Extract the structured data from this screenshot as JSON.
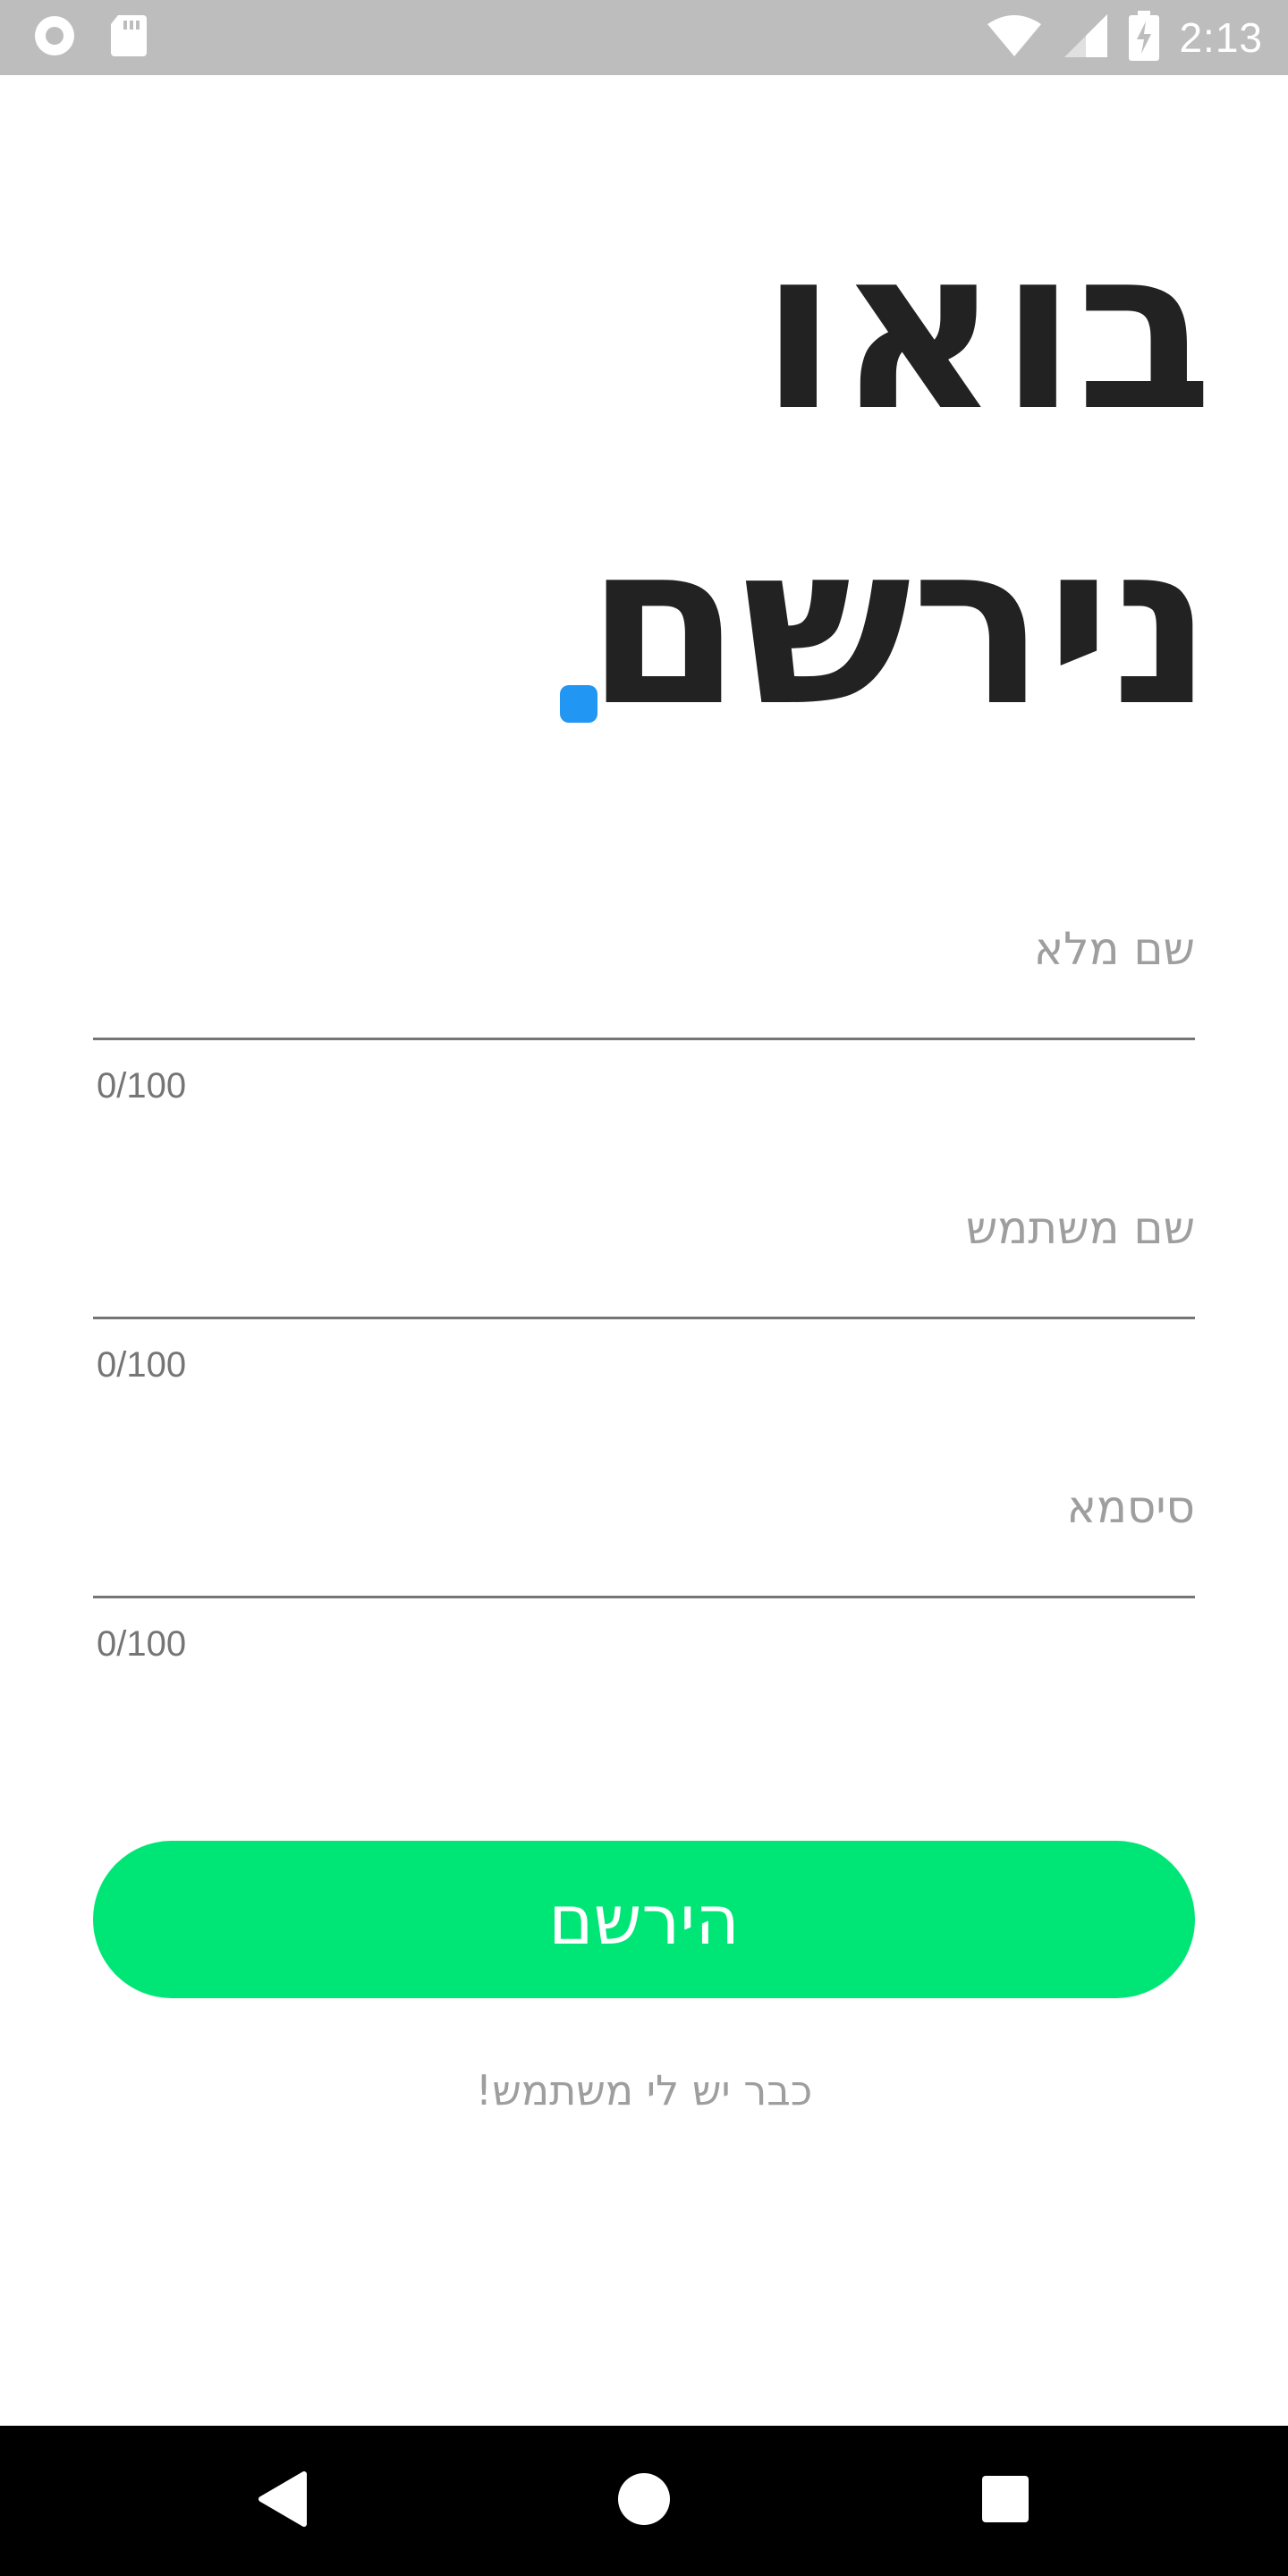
{
  "status_bar": {
    "time": "2:13",
    "left_icons": [
      "record-icon",
      "sd-card-icon"
    ],
    "right_icons": [
      "wifi-icon",
      "signal-icon",
      "battery-charging-icon"
    ]
  },
  "heading": {
    "line1": "בואו",
    "line2": "נירשם",
    "accent_color": "#2196f3"
  },
  "form": {
    "fields": [
      {
        "label": "שם מלא",
        "value": "",
        "counter": "0/100"
      },
      {
        "label": "שם משתמש",
        "value": "",
        "counter": "0/100"
      },
      {
        "label": "סיסמא",
        "value": "",
        "counter": "0/100"
      }
    ],
    "submit_label": "הירשם",
    "submit_color": "#00e676",
    "login_link": "כבר יש לי משתמש!"
  },
  "nav_bar": {
    "buttons": [
      "back-icon",
      "home-icon",
      "recents-icon"
    ]
  }
}
